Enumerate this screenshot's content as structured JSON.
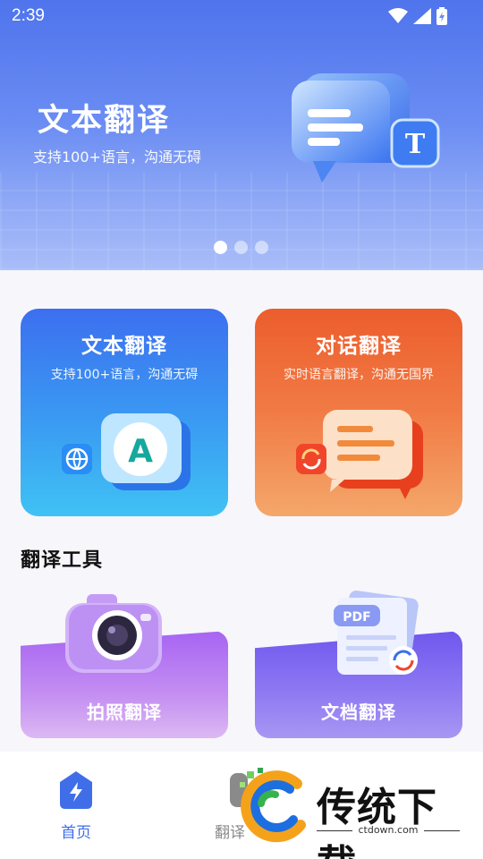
{
  "status_bar": {
    "time": "2:39"
  },
  "banner": {
    "title": "文本翻译",
    "subtitle": "支持100+语言，沟通无碍",
    "illustration_icon": "T"
  },
  "cards": [
    {
      "title": "文本翻译",
      "subtitle": "支持100+语言，沟通无碍",
      "icon": "A"
    },
    {
      "title": "对话翻译",
      "subtitle": "实时语言翻译，沟通无国界"
    }
  ],
  "section": {
    "title": "翻译工具"
  },
  "tools": [
    {
      "label": "拍照翻译"
    },
    {
      "label": "文档翻译",
      "icon": "PDF"
    }
  ],
  "bottom_nav": [
    {
      "label": "首页"
    },
    {
      "label": "翻译"
    }
  ],
  "watermark": {
    "brand": "传统下载",
    "url": "ctdown.com"
  },
  "colors": {
    "accent": "#3f6ee8",
    "banner": "#5a7ff0",
    "text_card": "#3a8ff2",
    "dialog_card": "#f17b45",
    "photo_card": "#b67bf2",
    "doc_card": "#7f69f0"
  }
}
